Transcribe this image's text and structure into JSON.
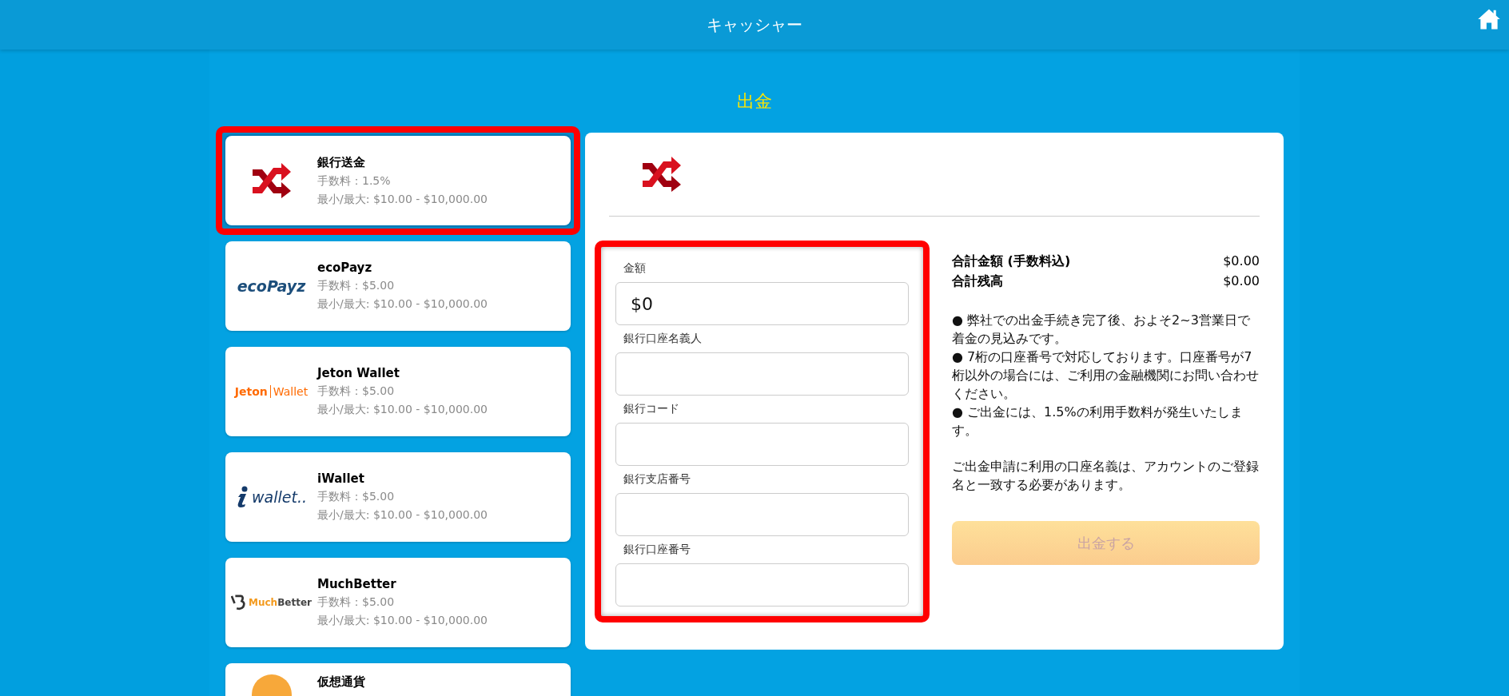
{
  "header": {
    "title": "キャッシャー"
  },
  "page_title": "出金",
  "methods": [
    {
      "name": "銀行送金",
      "fee": "手数料：1.5%",
      "limits": "最小/最大: $10.00 - $10,000.00",
      "kind": "shuffle",
      "selected": true,
      "highlighted": true
    },
    {
      "name": "ecoPayz",
      "fee": "手数料：$5.00",
      "limits": "最小/最大: $10.00 - $10,000.00",
      "kind": "ecopayz",
      "logo_text": "ecoPayz",
      "selected": false,
      "highlighted": false
    },
    {
      "name": "Jeton Wallet",
      "fee": "手数料：$5.00",
      "limits": "最小/最大: $10.00 - $10,000.00",
      "kind": "jeton",
      "logo_text": "Jeton",
      "logo_text_2": "Wallet",
      "selected": false,
      "highlighted": false
    },
    {
      "name": "iWallet",
      "fee": "手数料：$5.00",
      "limits": "最小/最大: $10.00 - $10,000.00",
      "kind": "iwallet",
      "logo_text": "wallet..",
      "selected": false,
      "highlighted": false
    },
    {
      "name": "MuchBetter",
      "fee": "手数料：$5.00",
      "limits": "最小/最大: $10.00 - $10,000.00",
      "kind": "muchbetter",
      "logo_text": "Much",
      "logo_text_2": "Better",
      "selected": false,
      "highlighted": false
    },
    {
      "name": "仮想通貨",
      "kind": "coin",
      "selected": false,
      "highlighted": false
    }
  ],
  "form": {
    "highlighted": true,
    "fields": [
      {
        "label": "金額",
        "value": "$0"
      },
      {
        "label": "銀行口座名義人"
      },
      {
        "label": "銀行コード"
      },
      {
        "label": "銀行支店番号"
      },
      {
        "label": "銀行口座番号"
      }
    ]
  },
  "summary": [
    {
      "label": "合計金額 (手数料込)",
      "value": "$0.00"
    },
    {
      "label": "合計残高",
      "value": "$0.00"
    }
  ],
  "notes": [
    "● 弊社での出金手続き完了後、およそ2~3営業日で着金の見込みです。",
    "● 7桁の口座番号で対応しております。口座番号が7桁以外の場合には、ご利用の金融機関にお問い合わせください。",
    "● ご出金には、1.5%の利用手数料が発生いたします。"
  ],
  "account_note": "ご出金申請に利用の口座名義は、アカウントのご登録名と一致する必要があります。",
  "submit": {
    "label": "出金する",
    "disabled": true
  }
}
